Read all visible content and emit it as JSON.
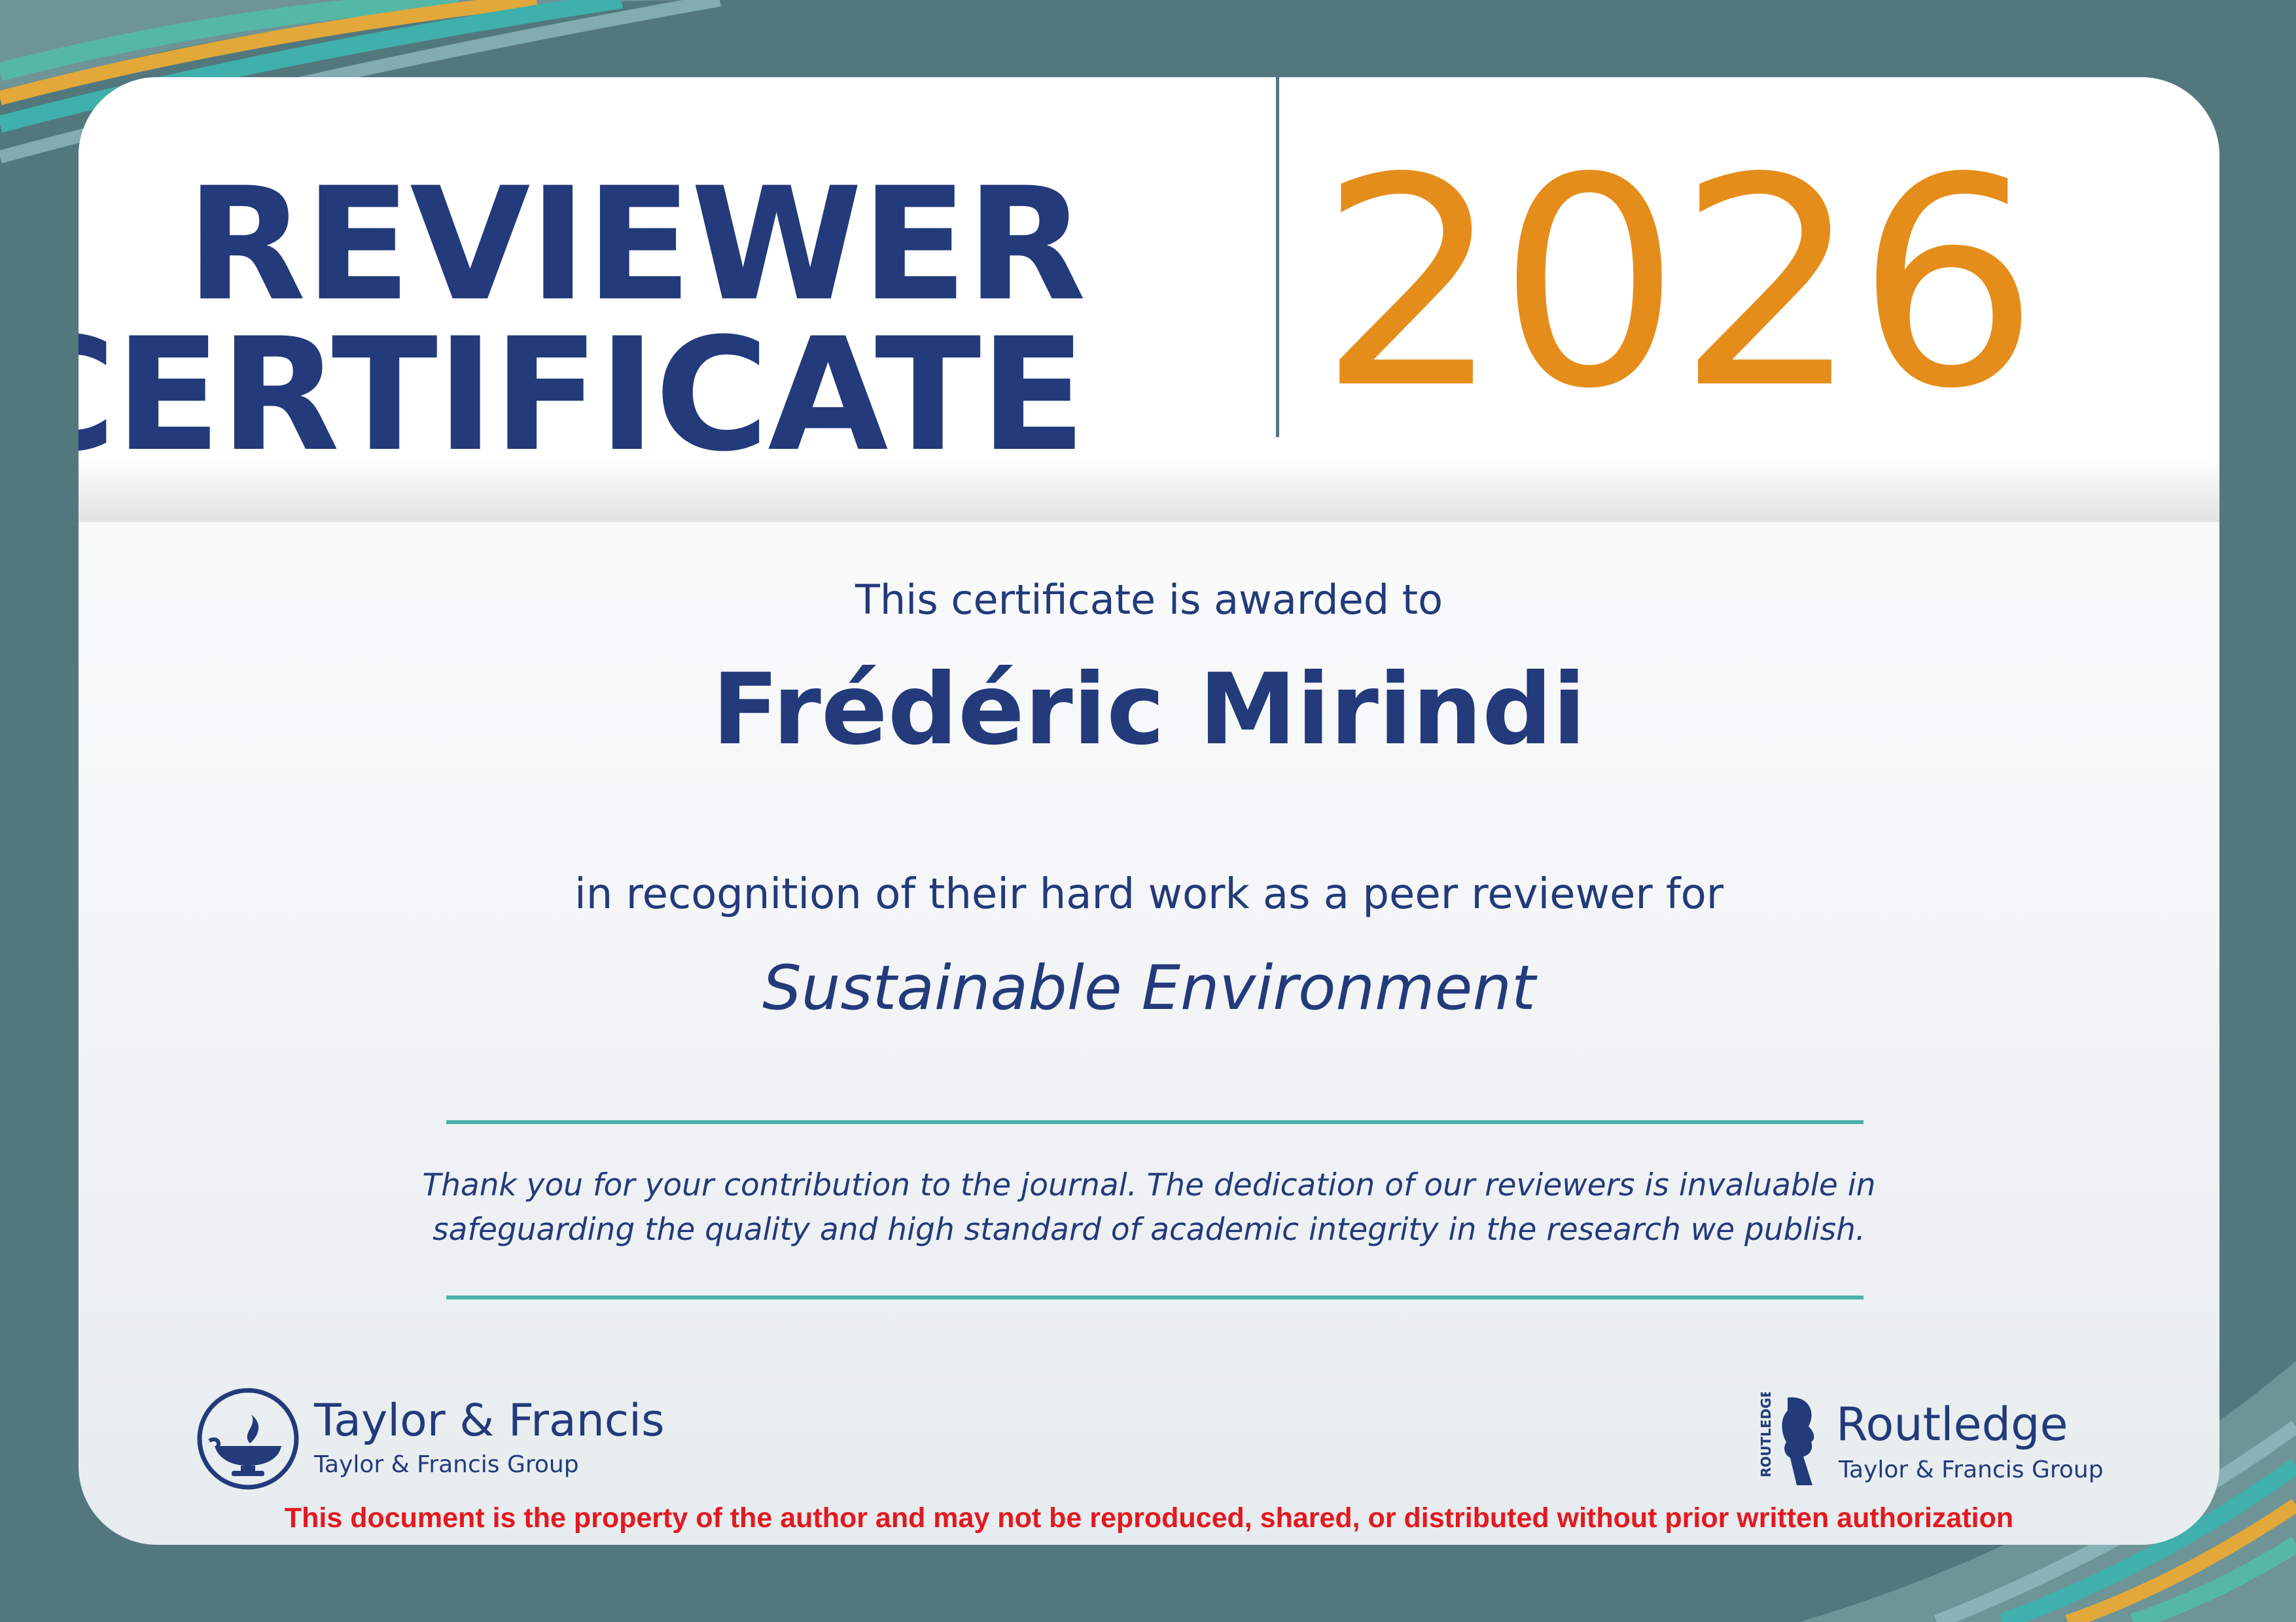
{
  "header": {
    "title_line1": "REVIEWER",
    "title_line2": "CERTIFICATE",
    "year": "2026"
  },
  "body": {
    "awarded_text": "This certificate is awarded to",
    "recipient_name": "Frédéric Mirindi",
    "recognition_text": "in recognition of their hard work as a peer reviewer for",
    "journal_name": "Sustainable Environment",
    "thanks_line1": "Thank you for your contribution to the journal. The dedication of our reviewers is invaluable in",
    "thanks_line2": "safeguarding the quality and high standard of academic integrity in the research we publish."
  },
  "logos": {
    "left": {
      "name": "Taylor & Francis",
      "group": "Taylor & Francis Group",
      "icon": "taylor-francis-lamp-icon"
    },
    "right": {
      "name": "Routledge",
      "group": "Taylor & Francis Group",
      "vertical_mark": "ROUTLEDGE",
      "icon": "routledge-profile-icon"
    }
  },
  "notice": "This document is the property of the author and may not be reproduced, shared, or distributed without prior written authorization",
  "colors": {
    "background": "#52787e",
    "navy": "#233a7b",
    "orange": "#e58d1b",
    "teal_rule": "#4ab1aa",
    "notice_red": "#e3191f"
  }
}
